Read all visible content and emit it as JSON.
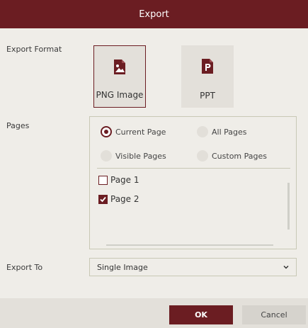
{
  "dialog": {
    "title": "Export"
  },
  "export_format": {
    "label": "Export Format",
    "options": [
      {
        "label": "PNG Image",
        "icon": "image-file-icon",
        "selected": true
      },
      {
        "label": "PPT",
        "icon": "ppt-file-icon",
        "selected": false
      }
    ]
  },
  "pages": {
    "label": "Pages",
    "radios": [
      {
        "label": "Current Page",
        "checked": true
      },
      {
        "label": "All Pages",
        "checked": false
      },
      {
        "label": "Visible Pages",
        "checked": false
      },
      {
        "label": "Custom Pages",
        "checked": false
      }
    ],
    "items": [
      {
        "label": "Page 1",
        "checked": false
      },
      {
        "label": "Page 2",
        "checked": true
      }
    ]
  },
  "export_to": {
    "label": "Export To",
    "value": "Single Image"
  },
  "buttons": {
    "ok": "OK",
    "cancel": "Cancel"
  },
  "colors": {
    "accent": "#6b1d22",
    "background": "#efede8",
    "panel": "#e3e0da"
  }
}
